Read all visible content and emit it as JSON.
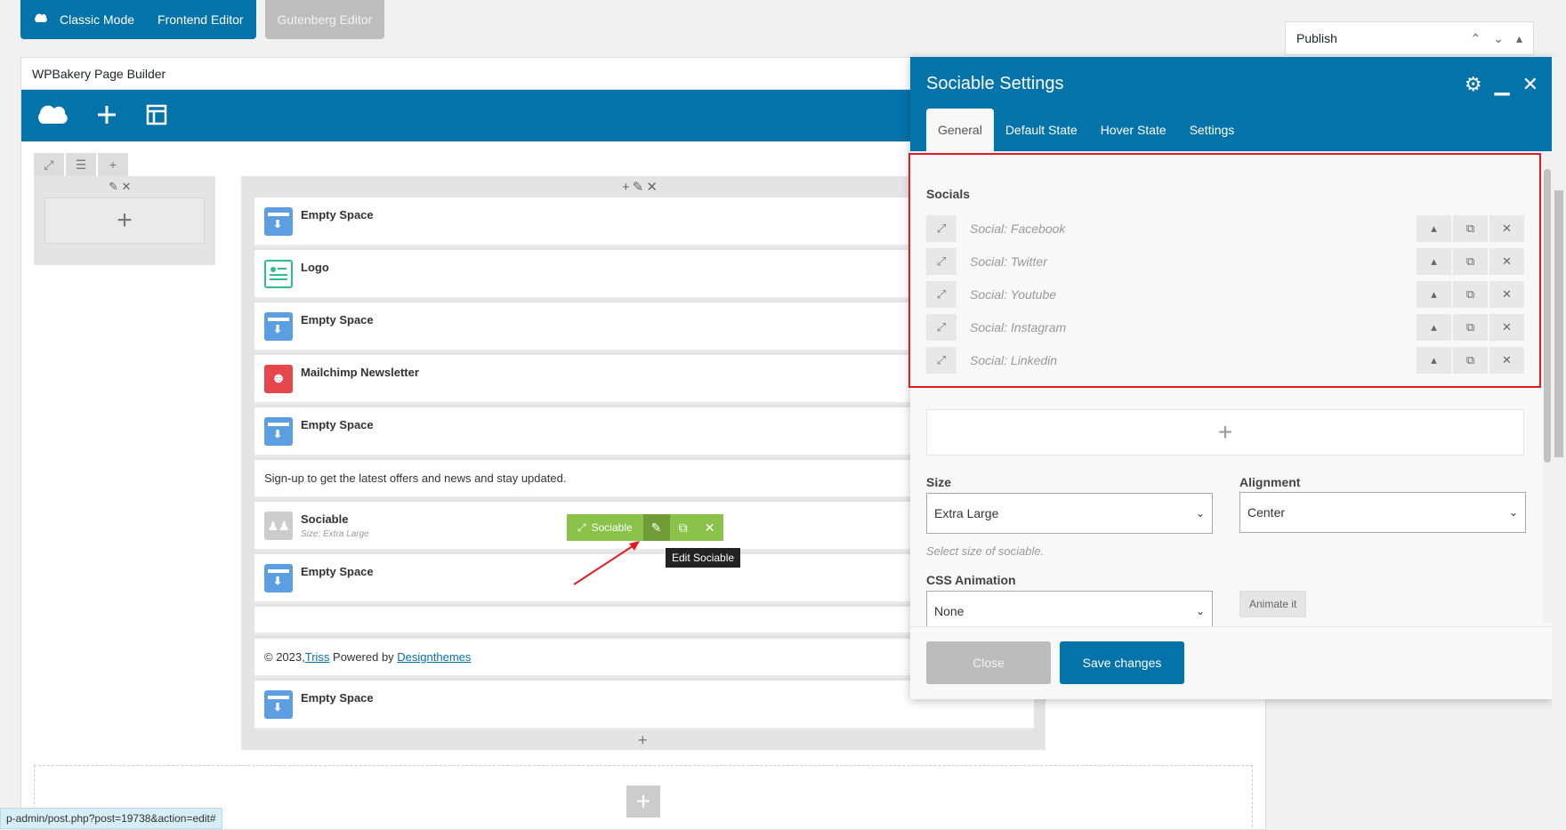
{
  "topbar": {
    "classic_mode": "Classic Mode",
    "frontend_editor": "Frontend Editor",
    "gutenberg_editor": "Gutenberg Editor"
  },
  "publish": {
    "title": "Publish"
  },
  "builder": {
    "title": "WPBakery Page Builder",
    "elements": [
      {
        "name": "Empty Space"
      },
      {
        "name": "Logo"
      },
      {
        "name": "Empty Space"
      },
      {
        "name": "Mailchimp Newsletter"
      },
      {
        "name": "Empty Space"
      },
      {
        "text": "Sign-up to get the latest offers and news and stay updated."
      },
      {
        "name": "Sociable",
        "sub": "Size: Extra Large"
      },
      {
        "name": "Empty Space"
      },
      {
        "copyright_prefix": "© 2023, ",
        "link1": "Triss",
        "middle": " Powered by ",
        "link2": "Designthemes"
      },
      {
        "name": "Empty Space"
      }
    ],
    "sociable_label": "Sociable",
    "tooltip": "Edit Sociable"
  },
  "statusbar": {
    "url": "p-admin/post.php?post=19738&action=edit#"
  },
  "modal": {
    "title": "Sociable Settings",
    "tabs": [
      "General",
      "Default State",
      "Hover State",
      "Settings"
    ],
    "socials_label": "Socials",
    "socials": [
      "Social: Facebook",
      "Social: Twitter",
      "Social: Youtube",
      "Social: Instagram",
      "Social: Linkedin"
    ],
    "size_label": "Size",
    "size_value": "Extra Large",
    "size_help": "Select size of sociable.",
    "alignment_label": "Alignment",
    "alignment_value": "Center",
    "animation_label": "CSS Animation",
    "animation_value": "None",
    "animate_btn": "Animate it",
    "close_btn": "Close",
    "save_btn": "Save changes"
  },
  "colors": {
    "primary": "#0473aa",
    "highlight": "#e31b23",
    "element_green": "#8bc34a"
  }
}
